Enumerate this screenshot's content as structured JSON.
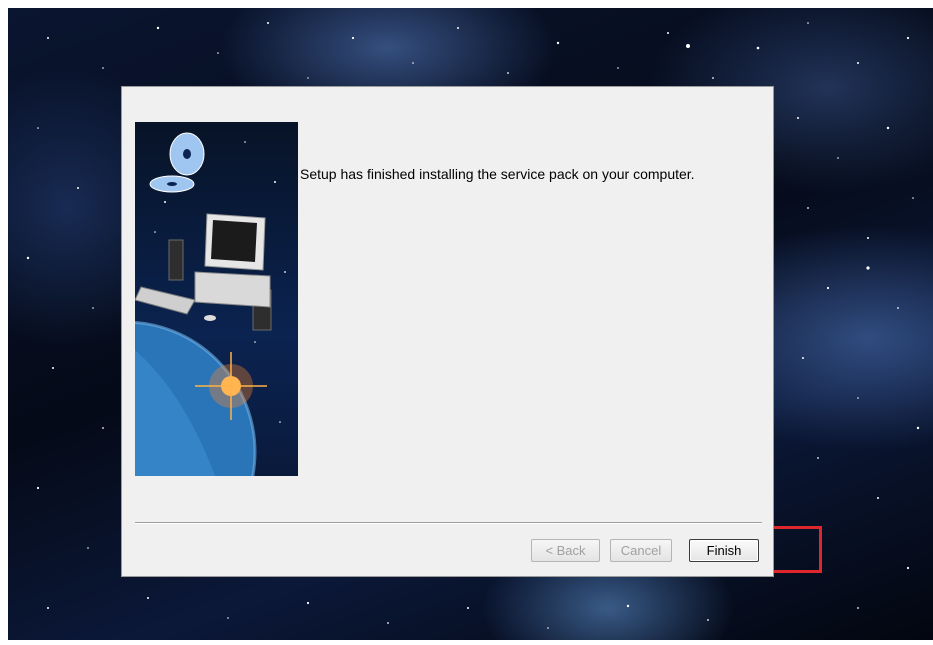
{
  "wizard": {
    "message": "Setup has finished installing the service pack on your computer."
  },
  "buttons": {
    "back_label": "< Back",
    "cancel_label": "Cancel",
    "finish_label": "Finish"
  },
  "colors": {
    "highlight": "#e0262d",
    "dialog_background": "#f0f0f0"
  },
  "icons": {
    "side_image": "computer-planet-cd-illustration"
  }
}
